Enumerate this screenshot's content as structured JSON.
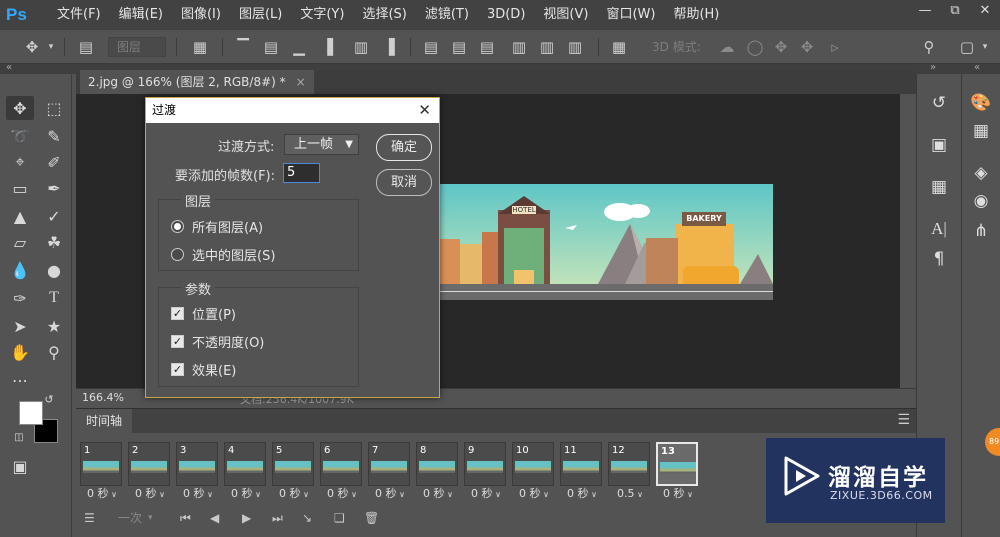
{
  "app": {
    "logo": "Ps",
    "menu": [
      "文件(F)",
      "编辑(E)",
      "图像(I)",
      "图层(L)",
      "文字(Y)",
      "选择(S)",
      "滤镜(T)",
      "3D(D)",
      "视图(V)",
      "窗口(W)",
      "帮助(H)"
    ],
    "window_controls": [
      "minimize-icon",
      "restore-icon",
      "close-icon"
    ]
  },
  "options_bar": {
    "layer_dropdown": "图层",
    "mode_3d_label": "3D 模式:"
  },
  "document_tab": {
    "title": "2.jpg @ 166% (图层 2, RGB/8#) *",
    "close": "×"
  },
  "status_bar": {
    "zoom": "166.4%",
    "doc_size": "文档:256.4K/1007.9K"
  },
  "timeline": {
    "panel_title": "时间轴",
    "frames": [
      {
        "num": "1",
        "delay": "0 秒"
      },
      {
        "num": "2",
        "delay": "0 秒"
      },
      {
        "num": "3",
        "delay": "0 秒"
      },
      {
        "num": "4",
        "delay": "0 秒"
      },
      {
        "num": "5",
        "delay": "0 秒"
      },
      {
        "num": "6",
        "delay": "0 秒"
      },
      {
        "num": "7",
        "delay": "0 秒"
      },
      {
        "num": "8",
        "delay": "0 秒"
      },
      {
        "num": "9",
        "delay": "0 秒"
      },
      {
        "num": "10",
        "delay": "0 秒"
      },
      {
        "num": "11",
        "delay": "0 秒"
      },
      {
        "num": "12",
        "delay": "0.5"
      },
      {
        "num": "13",
        "delay": "0 秒"
      }
    ],
    "selected_frame": "13",
    "loop_dropdown": "一次"
  },
  "dialog": {
    "title": "过渡",
    "tween_with_label": "过渡方式:",
    "tween_with_value": "上一帧",
    "frames_to_add_label": "要添加的帧数(F):",
    "frames_to_add_value": "5",
    "ok_button": "确定",
    "cancel_button": "取消",
    "layers_group": {
      "legend": "图层",
      "options": [
        "所有图层(A)",
        "选中的图层(S)"
      ],
      "selected": "所有图层(A)"
    },
    "params_group": {
      "legend": "参数",
      "checks": [
        {
          "label": "位置(P)",
          "checked": true
        },
        {
          "label": "不透明度(O)",
          "checked": true
        },
        {
          "label": "效果(E)",
          "checked": true
        }
      ]
    }
  },
  "image": {
    "hotel_sign": "HOTEL",
    "bakery_sign": "BAKERY"
  },
  "watermark": {
    "title": "溜溜自学",
    "url": "ZIXUE.3D66.COM"
  },
  "badge": "89",
  "colors": {
    "foreground": "#ffffff",
    "background": "#000000",
    "ps_blue": "#31a8ff",
    "dialog_border": "#c9a54a"
  }
}
